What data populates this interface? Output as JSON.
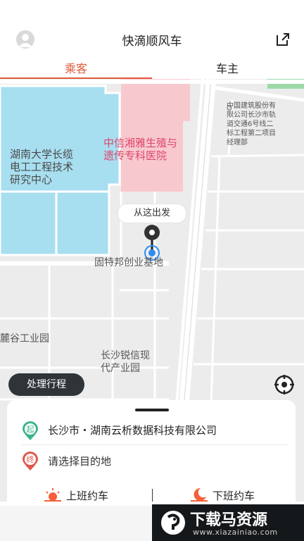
{
  "header": {
    "title": "快滴顺风车",
    "avatar_icon": "avatar-icon",
    "share_icon": "share-icon"
  },
  "tabs": [
    {
      "label": "乘客",
      "active": true
    },
    {
      "label": "车主",
      "active": false
    }
  ],
  "map": {
    "labels": {
      "hospital": "中信湘雅生殖与\n遗传专科医院",
      "university": "湖南大学长缆\n电工工程技术\n研究中心",
      "cscec": "中国建筑股份有\n限公司长沙市轨\n道交通6号线二\n标工程第二项目\n经理部",
      "ruixin": "长沙锐信现\n代产业园",
      "lugu": "麓谷工业园",
      "gutebang": "固特邦创业基地"
    },
    "from_here": "从这出发",
    "process_trip": "处理行程",
    "locate_icon": "locate-icon"
  },
  "route": {
    "start_badge": "起",
    "start_text": "长沙市・湖南云析数据科技有限公司",
    "end_badge": "终",
    "end_text": "请选择目的地"
  },
  "actions": {
    "commute_to_work": "上班约车",
    "commute_home": "下班约车"
  },
  "watermark": {
    "title": "下载马资源",
    "url": "www.xiazainiao.com"
  },
  "colors": {
    "accent": "#e05a3a",
    "start_green": "#3bb58a",
    "end_red": "#e0564b",
    "map_water": "#a8dff0",
    "map_pink": "#f7c9cf",
    "pin_blue": "#2f8ef0"
  }
}
